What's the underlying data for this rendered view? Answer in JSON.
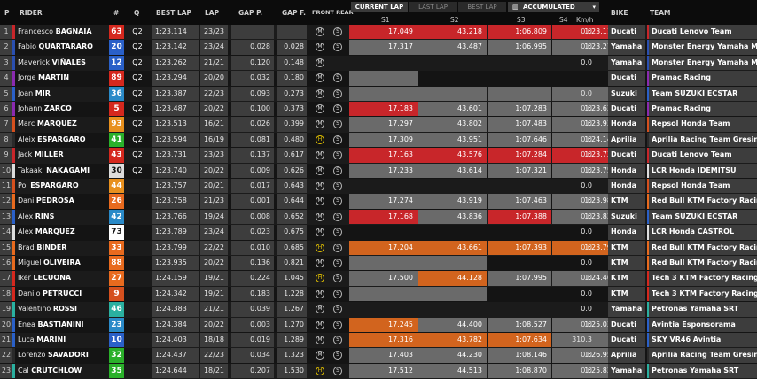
{
  "headers": {
    "pos": "P",
    "rider": "RIDER",
    "num": "#",
    "q": "Q",
    "best_lap": "BEST LAP",
    "lap": "LAP",
    "gap_p": "GAP P.",
    "gap_f": "GAP F.",
    "tyres": "FRONT REAR",
    "s1": "S1",
    "s2": "S2",
    "s3": "S3",
    "s4": "S4",
    "kmh": "Km/h",
    "bike": "BIKE",
    "team": "TEAM"
  },
  "tabs": {
    "current": "CURRENT LAP",
    "last": "LAST LAP",
    "best": "BEST LAP",
    "accumulated": "ACCUMULATED",
    "accumulated_icon": "chart-icon",
    "dropdown_icon": "chevron-down-icon"
  },
  "colors": {
    "red": "#c8262a",
    "orange": "#d2641e",
    "grey": "#6a6a6a",
    "dark": "#242424"
  },
  "rows": [
    {
      "pos": "1",
      "first": "Francesco",
      "last": "BAGNAIA",
      "num": "63",
      "num_bg": "#d5281e",
      "num_fg": "#ffffff",
      "q": "Q2",
      "best": "1:23.114",
      "lap": "23/23",
      "gap_p": "",
      "gap_f": "",
      "front": "M",
      "rear": "S",
      "fh": false,
      "s1": "17.049",
      "s1c": "red",
      "s2": "43.218",
      "s2c": "red",
      "s3": "1:06.809",
      "s3c": "red",
      "s4": "1:23.114",
      "s4c": "red",
      "kmh": "0.0",
      "bike": "Ducati",
      "team": "Ducati Lenovo Team",
      "accent": "#c8262a"
    },
    {
      "pos": "2",
      "first": "Fabio",
      "last": "QUARTARARO",
      "num": "20",
      "num_bg": "#2a60c8",
      "num_fg": "#ffffff",
      "q": "Q2",
      "best": "1:23.142",
      "lap": "23/24",
      "gap_p": "0.028",
      "gap_f": "0.028",
      "front": "M",
      "rear": "S",
      "fh": false,
      "s1": "17.317",
      "s1c": "grey",
      "s2": "43.487",
      "s2c": "grey",
      "s3": "1:06.995",
      "s3c": "grey",
      "s4": "1:23.272",
      "s4c": "grey",
      "kmh": "0.0",
      "bike": "Yamaha",
      "team": "Monster Energy Yamaha Moto...",
      "accent": "#2a4fb0"
    },
    {
      "pos": "3",
      "first": "Maverick",
      "last": "VIÑALES",
      "num": "12",
      "num_bg": "#2a60c8",
      "num_fg": "#ffffff",
      "q": "Q2",
      "best": "1:23.262",
      "lap": "21/21",
      "gap_p": "0.120",
      "gap_f": "0.148",
      "front": "M",
      "rear": "",
      "fh": false,
      "s1": "",
      "s1c": "",
      "s2": "",
      "s2c": "",
      "s3": "",
      "s3c": "",
      "s4": "",
      "s4c": "",
      "kmh": "0.0",
      "bike": "Yamaha",
      "team": "Monster Energy Yamaha Moto...",
      "accent": "#2a4fb0"
    },
    {
      "pos": "4",
      "first": "Jorge",
      "last": "MARTIN",
      "num": "89",
      "num_bg": "#d5281e",
      "num_fg": "#ffffff",
      "q": "Q2",
      "best": "1:23.294",
      "lap": "20/20",
      "gap_p": "0.032",
      "gap_f": "0.180",
      "front": "M",
      "rear": "S",
      "fh": false,
      "s1": "",
      "s1c": "grey",
      "s1w": 0.5,
      "s2": "",
      "s2c": "",
      "s3": "",
      "s3c": "",
      "s4": "",
      "s4c": "",
      "kmh": "",
      "bike": "Ducati",
      "team": "Pramac Racing",
      "accent": "#8a2ab0"
    },
    {
      "pos": "5",
      "first": "Joan",
      "last": "MIR",
      "num": "36",
      "num_bg": "#2a8ac8",
      "num_fg": "#ffffff",
      "q": "Q2",
      "best": "1:23.387",
      "lap": "22/23",
      "gap_p": "0.093",
      "gap_f": "0.273",
      "front": "M",
      "rear": "S",
      "fh": false,
      "s1": "",
      "s1c": "grey",
      "s2": "",
      "s2c": "grey",
      "s3": "",
      "s3c": "grey",
      "s4": "",
      "s4c": "grey",
      "s4w": 0.3,
      "kmh": "0.0",
      "bike": "Suzuki",
      "team": "Team SUZUKI ECSTAR",
      "accent": "#2a60c8"
    },
    {
      "pos": "6",
      "first": "Johann",
      "last": "ZARCO",
      "num": "5",
      "num_bg": "#d5281e",
      "num_fg": "#ffffff",
      "q": "Q2",
      "best": "1:23.487",
      "lap": "20/22",
      "gap_p": "0.100",
      "gap_f": "0.373",
      "front": "M",
      "rear": "S",
      "fh": false,
      "s1": "17.183",
      "s1c": "red",
      "s2": "43.601",
      "s2c": "grey",
      "s3": "1:07.283",
      "s3c": "grey",
      "s4": "1:23.634",
      "s4c": "grey",
      "kmh": "0.0",
      "bike": "Ducati",
      "team": "Pramac Racing",
      "accent": "#8a2ab0"
    },
    {
      "pos": "7",
      "first": "Marc",
      "last": "MARQUEZ",
      "num": "93",
      "num_bg": "#e8901e",
      "num_fg": "#ffffff",
      "q": "Q2",
      "best": "1:23.513",
      "lap": "16/21",
      "gap_p": "0.026",
      "gap_f": "0.399",
      "front": "M",
      "rear": "S",
      "fh": false,
      "s1": "17.297",
      "s1c": "grey",
      "s2": "43.802",
      "s2c": "grey",
      "s3": "1:07.483",
      "s3c": "grey",
      "s4": "1:23.938",
      "s4c": "grey",
      "kmh": "0.0",
      "bike": "Honda",
      "team": "Repsol Honda Team",
      "accent": "#d5501e"
    },
    {
      "pos": "8",
      "first": "Aleix",
      "last": "ESPARGARO",
      "num": "41",
      "num_bg": "#2ab02a",
      "num_fg": "#ffffff",
      "q": "Q2",
      "best": "1:23.594",
      "lap": "16/19",
      "gap_p": "0.081",
      "gap_f": "0.480",
      "front": "H",
      "rear": "S",
      "fh": true,
      "s1": "17.309",
      "s1c": "grey",
      "s2": "43.951",
      "s2c": "grey",
      "s3": "1:07.646",
      "s3c": "grey",
      "s4": "1:24.142",
      "s4c": "grey",
      "kmh": "0.0",
      "bike": "Aprilia",
      "team": "Aprilia Racing Team Gresini",
      "accent": "#2a2a2a"
    },
    {
      "pos": "9",
      "first": "Jack",
      "last": "MILLER",
      "num": "43",
      "num_bg": "#d5281e",
      "num_fg": "#ffffff",
      "q": "Q2",
      "best": "1:23.731",
      "lap": "23/23",
      "gap_p": "0.137",
      "gap_f": "0.617",
      "front": "M",
      "rear": "S",
      "fh": false,
      "s1": "17.163",
      "s1c": "red",
      "s2": "43.576",
      "s2c": "red",
      "s3": "1:07.284",
      "s3c": "red",
      "s4": "1:23.731",
      "s4c": "red",
      "kmh": "0.0",
      "bike": "Ducati",
      "team": "Ducati Lenovo Team",
      "accent": "#c8262a"
    },
    {
      "pos": "10",
      "first": "Takaaki",
      "last": "NAKAGAMI",
      "num": "30",
      "num_bg": "#dddddd",
      "num_fg": "#111111",
      "q": "Q2",
      "best": "1:23.740",
      "lap": "20/22",
      "gap_p": "0.009",
      "gap_f": "0.626",
      "front": "M",
      "rear": "S",
      "fh": false,
      "s1": "17.233",
      "s1c": "grey",
      "s2": "43.614",
      "s2c": "grey",
      "s3": "1:07.321",
      "s3c": "grey",
      "s4": "1:23.755",
      "s4c": "grey",
      "kmh": "0.0",
      "bike": "Honda",
      "team": "LCR Honda IDEMITSU",
      "accent": "#dddddd"
    },
    {
      "pos": "11",
      "first": "Pol",
      "last": "ESPARGARO",
      "num": "44",
      "num_bg": "#e8901e",
      "num_fg": "#ffffff",
      "q": "",
      "best": "1:23.757",
      "lap": "20/21",
      "gap_p": "0.017",
      "gap_f": "0.643",
      "front": "M",
      "rear": "S",
      "fh": false,
      "s1": "",
      "s1c": "",
      "s2": "",
      "s2c": "",
      "s3": "",
      "s3c": "",
      "s4": "",
      "s4c": "",
      "kmh": "0.0",
      "bike": "Honda",
      "team": "Repsol Honda Team",
      "accent": "#d5501e"
    },
    {
      "pos": "12",
      "first": "Dani",
      "last": "PEDROSA",
      "num": "26",
      "num_bg": "#e86a1e",
      "num_fg": "#ffffff",
      "q": "",
      "best": "1:23.758",
      "lap": "21/23",
      "gap_p": "0.001",
      "gap_f": "0.644",
      "front": "M",
      "rear": "S",
      "fh": false,
      "s1": "17.274",
      "s1c": "grey",
      "s2": "43.919",
      "s2c": "grey",
      "s3": "1:07.463",
      "s3c": "grey",
      "s4": "1:23.982",
      "s4c": "grey",
      "kmh": "0.0",
      "bike": "KTM",
      "team": "Red Bull KTM Factory Racing",
      "accent": "#e86a1e"
    },
    {
      "pos": "13",
      "first": "Alex",
      "last": "RINS",
      "num": "42",
      "num_bg": "#2a8ac8",
      "num_fg": "#ffffff",
      "q": "",
      "best": "1:23.766",
      "lap": "19/24",
      "gap_p": "0.008",
      "gap_f": "0.652",
      "front": "M",
      "rear": "S",
      "fh": false,
      "s1": "17.168",
      "s1c": "red",
      "s2": "43.836",
      "s2c": "grey",
      "s3": "1:07.388",
      "s3c": "red",
      "s4": "1:23.833",
      "s4c": "grey",
      "kmh": "0.0",
      "bike": "Suzuki",
      "team": "Team SUZUKI ECSTAR",
      "accent": "#2a60c8"
    },
    {
      "pos": "14",
      "first": "Alex",
      "last": "MARQUEZ",
      "num": "73",
      "num_bg": "#ffffff",
      "num_fg": "#111111",
      "q": "",
      "best": "1:23.789",
      "lap": "23/24",
      "gap_p": "0.023",
      "gap_f": "0.675",
      "front": "M",
      "rear": "S",
      "fh": false,
      "s1": "",
      "s1c": "",
      "s2": "",
      "s2c": "",
      "s3": "",
      "s3c": "",
      "s4": "",
      "s4c": "",
      "kmh": "0.0",
      "bike": "Honda",
      "team": "LCR Honda CASTROL",
      "accent": "#dddddd"
    },
    {
      "pos": "15",
      "first": "Brad",
      "last": "BINDER",
      "num": "33",
      "num_bg": "#e86a1e",
      "num_fg": "#ffffff",
      "q": "",
      "best": "1:23.799",
      "lap": "22/22",
      "gap_p": "0.010",
      "gap_f": "0.685",
      "front": "H",
      "rear": "S",
      "fh": true,
      "s1": "17.204",
      "s1c": "orange",
      "s2": "43.661",
      "s2c": "orange",
      "s3": "1:07.393",
      "s3c": "orange",
      "s4": "1:23.799",
      "s4c": "orange",
      "kmh": "0.0",
      "bike": "KTM",
      "team": "Red Bull KTM Factory Racing",
      "accent": "#e86a1e"
    },
    {
      "pos": "16",
      "first": "Miguel",
      "last": "OLIVEIRA",
      "num": "88",
      "num_bg": "#e86a1e",
      "num_fg": "#ffffff",
      "q": "",
      "best": "1:23.935",
      "lap": "20/22",
      "gap_p": "0.136",
      "gap_f": "0.821",
      "front": "M",
      "rear": "S",
      "fh": false,
      "s1": "",
      "s1c": "grey",
      "s2": "",
      "s2c": "grey",
      "s2w": 0.2,
      "s3": "",
      "s3c": "",
      "s4": "",
      "s4c": "",
      "kmh": "0.0",
      "bike": "KTM",
      "team": "Red Bull KTM Factory Racing",
      "accent": "#e86a1e"
    },
    {
      "pos": "17",
      "first": "Iker",
      "last": "LECUONA",
      "num": "27",
      "num_bg": "#e86a1e",
      "num_fg": "#ffffff",
      "q": "",
      "best": "1:24.159",
      "lap": "19/21",
      "gap_p": "0.224",
      "gap_f": "1.045",
      "front": "H",
      "rear": "S",
      "fh": true,
      "s1": "17.500",
      "s1c": "grey",
      "s2": "44.128",
      "s2c": "orange",
      "s3": "1:07.995",
      "s3c": "grey",
      "s4": "1:24.468",
      "s4c": "grey",
      "kmh": "0.0",
      "bike": "KTM",
      "team": "Tech 3 KTM Factory Racing",
      "accent": "#d5281e"
    },
    {
      "pos": "18",
      "first": "Danilo",
      "last": "PETRUCCI",
      "num": "9",
      "num_bg": "#d5501e",
      "num_fg": "#ffffff",
      "q": "",
      "best": "1:24.342",
      "lap": "19/21",
      "gap_p": "0.183",
      "gap_f": "1.228",
      "front": "M",
      "rear": "S",
      "fh": false,
      "s1": "",
      "s1c": "grey",
      "s2": "",
      "s2c": "grey",
      "s2w": 0.4,
      "s3": "",
      "s3c": "",
      "s4": "",
      "s4c": "",
      "kmh": "0.0",
      "bike": "KTM",
      "team": "Tech 3 KTM Factory Racing",
      "accent": "#d5281e"
    },
    {
      "pos": "19",
      "first": "Valentino",
      "last": "ROSSI",
      "num": "46",
      "num_bg": "#2ab0a0",
      "num_fg": "#ffffff",
      "q": "",
      "best": "1:24.383",
      "lap": "21/21",
      "gap_p": "0.039",
      "gap_f": "1.267",
      "front": "M",
      "rear": "S",
      "fh": false,
      "s1": "",
      "s1c": "",
      "s2": "",
      "s2c": "",
      "s3": "",
      "s3c": "",
      "s4": "",
      "s4c": "",
      "kmh": "0.0",
      "bike": "Yamaha",
      "team": "Petronas Yamaha SRT",
      "accent": "#2ab0a0"
    },
    {
      "pos": "20",
      "first": "Enea",
      "last": "BASTIANINI",
      "num": "23",
      "num_bg": "#2a8ac8",
      "num_fg": "#ffffff",
      "q": "",
      "best": "1:24.384",
      "lap": "20/22",
      "gap_p": "0.003",
      "gap_f": "1.270",
      "front": "M",
      "rear": "S",
      "fh": false,
      "s1": "17.245",
      "s1c": "orange",
      "s2": "44.400",
      "s2c": "grey",
      "s3": "1:08.527",
      "s3c": "grey",
      "s4": "1:25.037",
      "s4c": "grey",
      "kmh": "0.0",
      "bike": "Ducati",
      "team": "Avintia Esponsorama",
      "accent": "#2a60c8"
    },
    {
      "pos": "21",
      "first": "Luca",
      "last": "MARINI",
      "num": "10",
      "num_bg": "#2a60c8",
      "num_fg": "#ffffff",
      "q": "",
      "best": "1:24.403",
      "lap": "18/18",
      "gap_p": "0.019",
      "gap_f": "1.289",
      "front": "M",
      "rear": "S",
      "fh": false,
      "s1": "17.316",
      "s1c": "orange",
      "s2": "43.782",
      "s2c": "orange",
      "s3": "1:07.634",
      "s3c": "orange",
      "s4": "",
      "s4c": "grey",
      "s4w": 0.4,
      "kmh": "310.3",
      "bike": "Ducati",
      "team": "SKY VR46 Avintia",
      "accent": "#2a60c8"
    },
    {
      "pos": "22",
      "first": "Lorenzo",
      "last": "SAVADORI",
      "num": "32",
      "num_bg": "#2ab02a",
      "num_fg": "#ffffff",
      "q": "",
      "best": "1:24.437",
      "lap": "22/23",
      "gap_p": "0.034",
      "gap_f": "1.323",
      "front": "M",
      "rear": "S",
      "fh": false,
      "s1": "17.403",
      "s1c": "grey",
      "s2": "44.230",
      "s2c": "grey",
      "s3": "1:08.146",
      "s3c": "grey",
      "s4": "1:26.956",
      "s4c": "grey",
      "kmh": "0.0",
      "bike": "Aprilia",
      "team": "Aprilia Racing Team Gresini",
      "accent": "#2a2a2a"
    },
    {
      "pos": "23",
      "first": "Cal",
      "last": "CRUTCHLOW",
      "num": "35",
      "num_bg": "#2ab02a",
      "num_fg": "#ffffff",
      "q": "",
      "best": "1:24.644",
      "lap": "18/21",
      "gap_p": "0.207",
      "gap_f": "1.530",
      "front": "H",
      "rear": "S",
      "fh": true,
      "s1": "17.512",
      "s1c": "grey",
      "s2": "44.513",
      "s2c": "grey",
      "s3": "1:08.870",
      "s3c": "grey",
      "s4": "1:25.834",
      "s4c": "grey",
      "kmh": "0.0",
      "bike": "Yamaha",
      "team": "Petronas Yamaha SRT",
      "accent": "#2ab0a0"
    }
  ]
}
